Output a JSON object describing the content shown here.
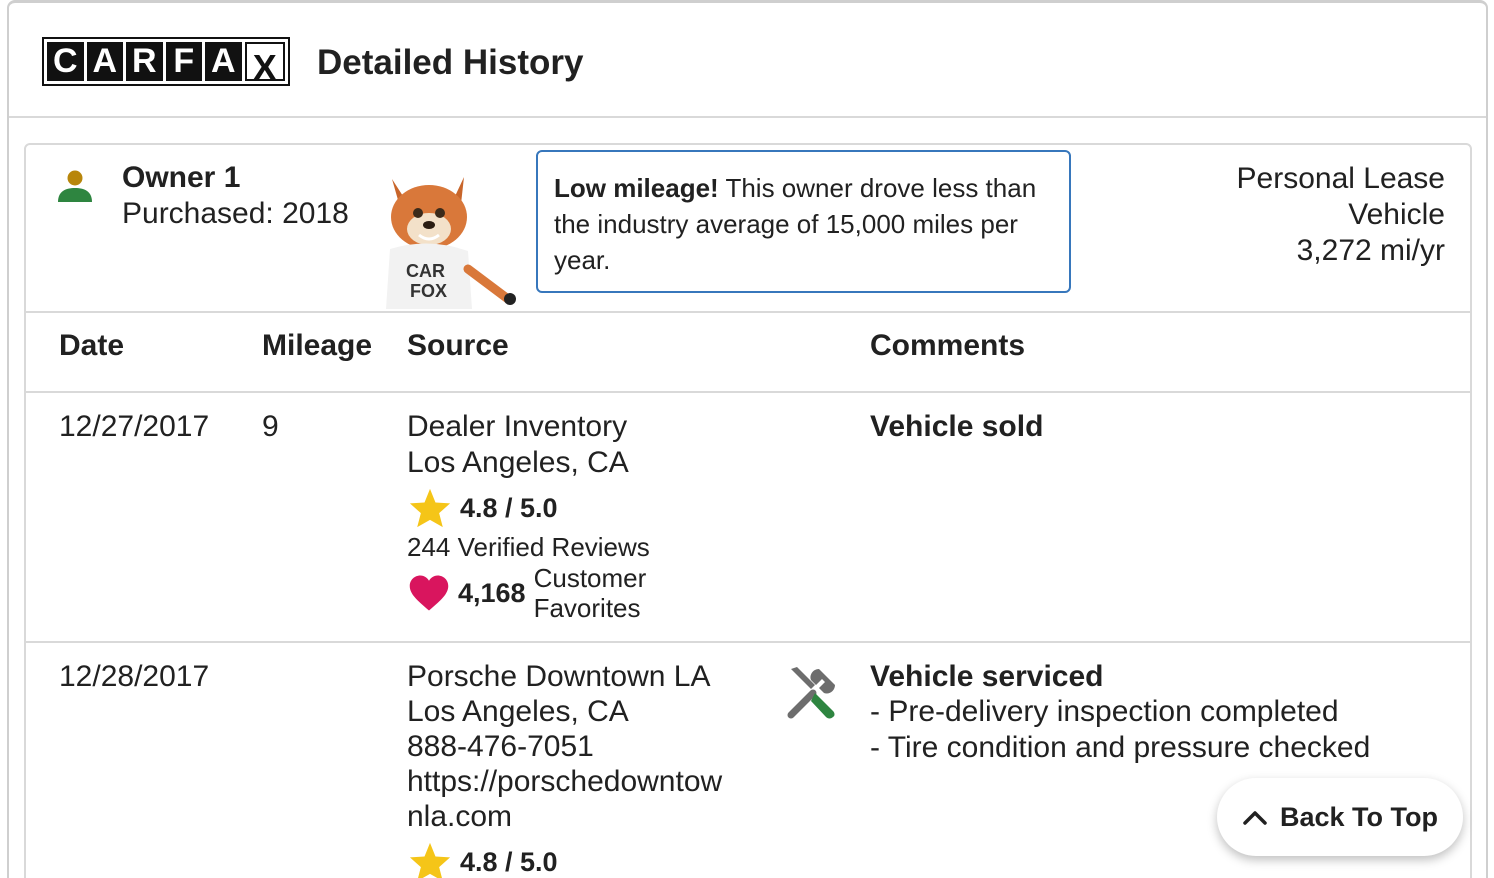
{
  "header": {
    "logo_letters": [
      "C",
      "A",
      "R",
      "F",
      "A",
      "X"
    ],
    "title": "Detailed History"
  },
  "owner": {
    "title": "Owner 1",
    "purchased": "Purchased: 2018",
    "tip_strong": "Low mileage!",
    "tip_text": " This owner drove less than the industry average of 15,000 miles per year.",
    "usage_line1": "Personal Lease",
    "usage_line2": "Vehicle",
    "usage_line3": "3,272 mi/yr",
    "icon_color": "#2e8540",
    "icon_head_color": "#b8860b"
  },
  "table": {
    "headers": {
      "date": "Date",
      "mileage": "Mileage",
      "source": "Source",
      "comments": "Comments"
    },
    "rows": [
      {
        "date": "12/27/2017",
        "mileage": "9",
        "source_line1": "Dealer Inventory",
        "source_line2": "Los Angeles, CA",
        "rating": "4.8 / 5.0",
        "reviews": "244 Verified Reviews",
        "favorites_count": "4,168",
        "favorites_label_1": "Customer",
        "favorites_label_2": "Favorites",
        "comment_title": "Vehicle sold"
      },
      {
        "date": "12/28/2017",
        "mileage": "",
        "source_line1": "Porsche Downtown LA",
        "source_line2": "Los Angeles, CA",
        "phone": "888-476-7051",
        "url_line1": "https://porschedowntow",
        "url_line2": "nla.com",
        "rating": "4.8 / 5.0",
        "comment_title": "Vehicle serviced",
        "comment_items": [
          "- Pre-delivery inspection completed",
          "- Tire condition and pressure checked"
        ]
      }
    ]
  },
  "back_to_top": {
    "label": "Back To Top"
  },
  "colors": {
    "star": "#f5c518",
    "heart": "#d9155e",
    "tip_border": "#3777bc",
    "wrench_green": "#2e8540"
  }
}
